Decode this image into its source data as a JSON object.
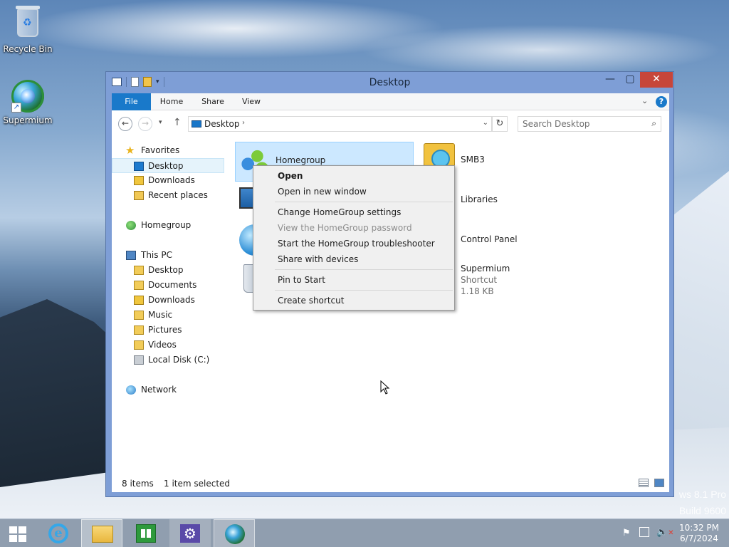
{
  "desktop": {
    "icons": [
      {
        "label": "Recycle Bin",
        "icon": "recycle-bin-icon"
      },
      {
        "label": "Supermium",
        "icon": "supermium-icon"
      }
    ],
    "watermark_line1": "ws 8.1 Pro",
    "watermark_line2": "Build 9600"
  },
  "window": {
    "title": "Desktop",
    "controls": {
      "minimize": "—",
      "maximize": "▢",
      "close": "✕"
    },
    "ribbon_tabs": [
      "File",
      "Home",
      "Share",
      "View"
    ],
    "address": {
      "location": "Desktop"
    },
    "search": {
      "placeholder": "Search Desktop"
    },
    "nav_pane": {
      "favorites": {
        "label": "Favorites",
        "items": [
          "Desktop",
          "Downloads",
          "Recent places"
        ]
      },
      "homegroup": "Homegroup",
      "this_pc": {
        "label": "This PC",
        "items": [
          "Desktop",
          "Documents",
          "Downloads",
          "Music",
          "Pictures",
          "Videos",
          "Local Disk (C:)"
        ]
      },
      "network": "Network"
    },
    "content_items": [
      {
        "name": "Homegroup",
        "selected": true
      },
      {
        "name": "SMB3"
      },
      {
        "name": "Libraries"
      },
      {
        "name": "Control Panel"
      },
      {
        "name": "Supermium",
        "type": "Shortcut",
        "size": "1.18 KB"
      }
    ],
    "status": {
      "count": "8 items",
      "selection": "1 item selected"
    }
  },
  "context_menu": {
    "items": [
      {
        "label": "Open",
        "bold": true
      },
      {
        "label": "Open in new window"
      },
      {
        "label": "Change HomeGroup settings"
      },
      {
        "label": "View the HomeGroup password",
        "disabled": true
      },
      {
        "label": "Start the HomeGroup troubleshooter"
      },
      {
        "label": "Share with devices"
      },
      {
        "label": "Pin to Start"
      },
      {
        "label": "Create shortcut"
      }
    ]
  },
  "taskbar": {
    "apps": [
      "start",
      "internet-explorer",
      "file-explorer",
      "store",
      "settings",
      "supermium"
    ],
    "clock": {
      "time": "10:32 PM",
      "date": "6/7/2024"
    }
  },
  "colors": {
    "accent": "#1979ca",
    "close": "#c7463a",
    "selection": "#cce8ff"
  }
}
